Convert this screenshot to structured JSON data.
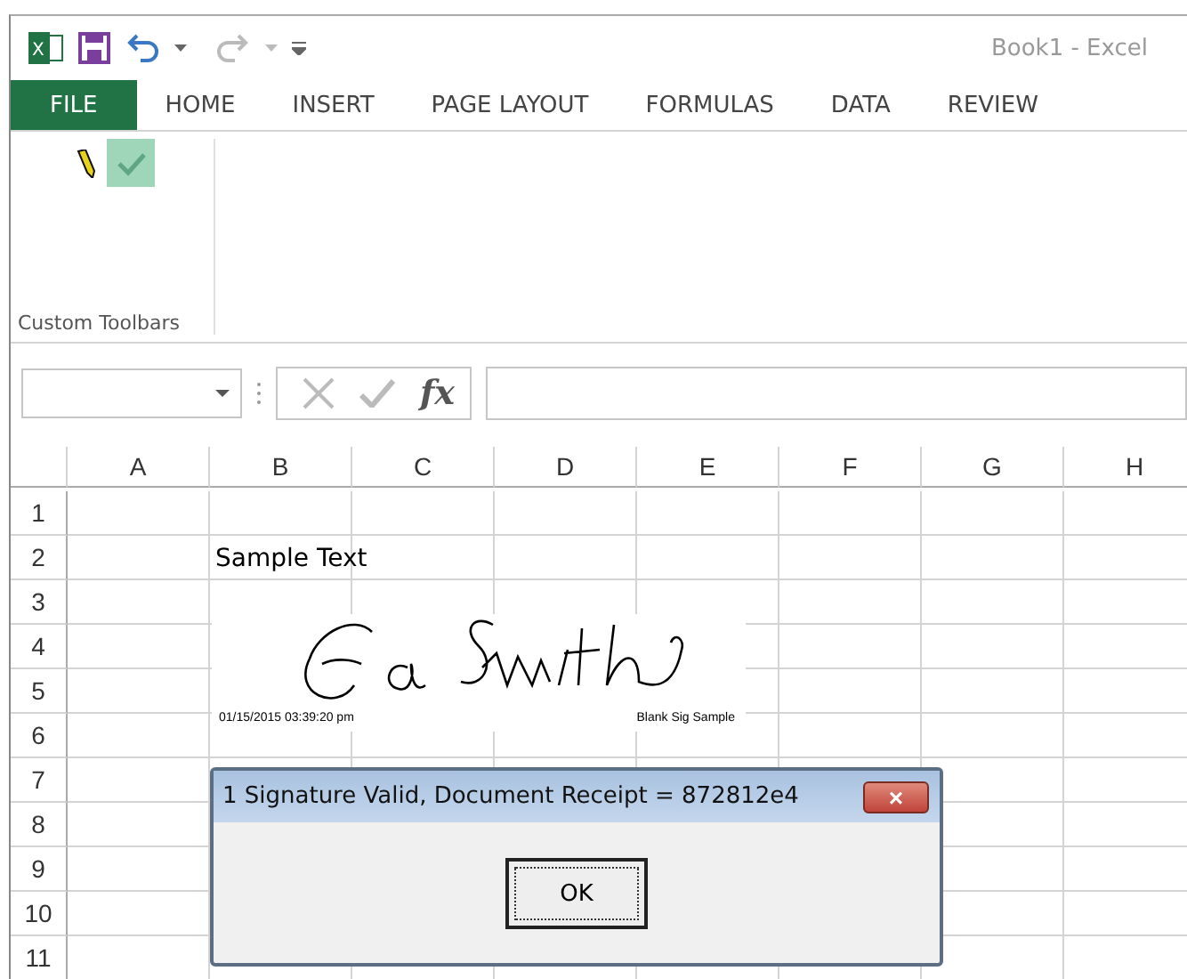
{
  "window": {
    "title": "Book1 - Excel",
    "logo_letter": "X"
  },
  "ribbon_tabs": [
    {
      "label": "FILE",
      "selected": true
    },
    {
      "label": "HOME",
      "selected": false
    },
    {
      "label": "INSERT",
      "selected": false
    },
    {
      "label": "PAGE LAYOUT",
      "selected": false
    },
    {
      "label": "FORMULAS",
      "selected": false
    },
    {
      "label": "DATA",
      "selected": false
    },
    {
      "label": "REVIEW",
      "selected": false
    }
  ],
  "ribbon_group": {
    "label": "Custom Toolbars",
    "check_button": {
      "selected": true
    }
  },
  "formula_bar": {
    "fx": "fx"
  },
  "sheet": {
    "columns": [
      "A",
      "B",
      "C",
      "D",
      "E",
      "F",
      "G",
      "H"
    ],
    "rows": [
      {
        "number": "1"
      },
      {
        "number": "2",
        "column_b": "Sample Text"
      },
      {
        "number": "3"
      },
      {
        "number": "4"
      },
      {
        "number": "5"
      },
      {
        "number": "6"
      },
      {
        "number": "7"
      },
      {
        "number": "8"
      },
      {
        "number": "9"
      },
      {
        "number": "10"
      },
      {
        "number": "11"
      }
    ],
    "signature": {
      "timestamp": "01/15/2015 03:39:20 pm",
      "caption": "Blank Sig Sample"
    }
  },
  "dialog": {
    "title": "1 Signature Valid, Document Receipt = 872812e4",
    "close": "×",
    "button": "OK"
  }
}
